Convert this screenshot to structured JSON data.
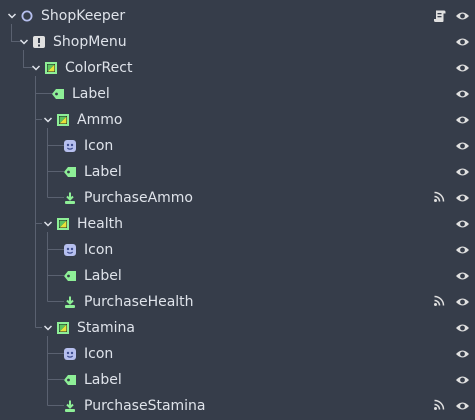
{
  "scene_tree": {
    "rows": [
      {
        "label": "ShopKeeper",
        "icon": "node-icon",
        "expander": "expanded",
        "extra_icon": "script-icon"
      },
      {
        "label": "ShopMenu",
        "icon": "warning-icon",
        "expander": "expanded"
      },
      {
        "label": "ColorRect",
        "icon": "color-rect-icon",
        "expander": "expanded"
      },
      {
        "label": "Label",
        "icon": "label-icon",
        "expander": "none"
      },
      {
        "label": "Ammo",
        "icon": "color-rect-icon",
        "expander": "expanded"
      },
      {
        "label": "Icon",
        "icon": "texture-rect-icon",
        "expander": "none"
      },
      {
        "label": "Label",
        "icon": "label-icon",
        "expander": "none"
      },
      {
        "label": "PurchaseAmmo",
        "icon": "button-icon",
        "expander": "none",
        "extra_icon": "signal-icon"
      },
      {
        "label": "Health",
        "icon": "color-rect-icon",
        "expander": "expanded"
      },
      {
        "label": "Icon",
        "icon": "texture-rect-icon",
        "expander": "none"
      },
      {
        "label": "Label",
        "icon": "label-icon",
        "expander": "none"
      },
      {
        "label": "PurchaseHealth",
        "icon": "button-icon",
        "expander": "none",
        "extra_icon": "signal-icon"
      },
      {
        "label": "Stamina",
        "icon": "color-rect-icon",
        "expander": "expanded"
      },
      {
        "label": "Icon",
        "icon": "texture-rect-icon",
        "expander": "none"
      },
      {
        "label": "Label",
        "icon": "label-icon",
        "expander": "none"
      },
      {
        "label": "PurchaseStamina",
        "icon": "button-icon",
        "expander": "none",
        "extra_icon": "signal-icon"
      }
    ]
  },
  "colors": {
    "background": "#363d4a",
    "text": "#dfe3ea",
    "guide": "#5a6170",
    "control_green": "#8eef97",
    "node_lavender": "#b6bfee",
    "icon_light": "#e0e0e0"
  }
}
